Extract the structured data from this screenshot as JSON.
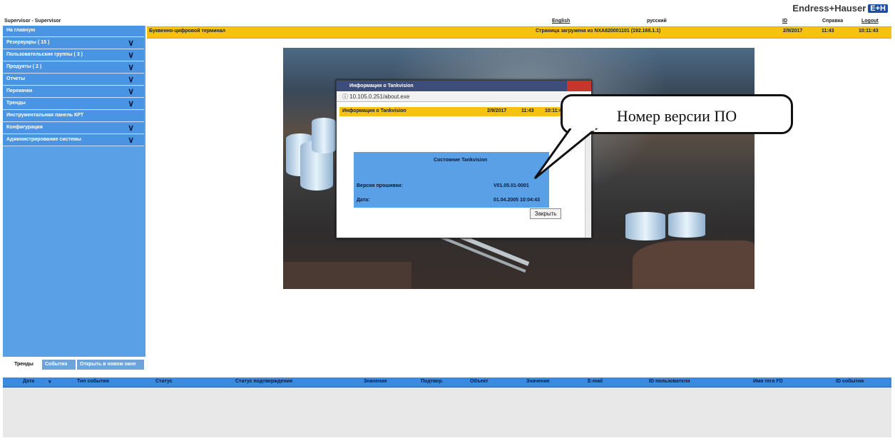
{
  "header": {
    "user": "Supervisor - Supervisor",
    "language_link": "English",
    "language_current": "русский",
    "link_id": "ID",
    "help": "Справка",
    "logout": "Logout",
    "brand": "Endress+Hauser",
    "brand_badge": "E+H"
  },
  "sidebar": {
    "items": [
      {
        "label": "На главную",
        "chevron": false
      },
      {
        "label": "Резервуары ( 15 )",
        "chevron": true
      },
      {
        "label": "Пользовательские группы ( 3 )",
        "chevron": true
      },
      {
        "label": "Продукты ( 2 )",
        "chevron": true
      },
      {
        "label": "Отчеты",
        "chevron": true
      },
      {
        "label": "Перекачки",
        "chevron": true
      },
      {
        "label": "Тренды",
        "chevron": true
      },
      {
        "label": "Инструментальная панель КРТ",
        "chevron": false
      },
      {
        "label": "Конфигурация",
        "chevron": true
      },
      {
        "label": "Администрирование системы",
        "chevron": true
      }
    ]
  },
  "titlebar": {
    "title": "Буквенно-цифровой терминал",
    "status": "Страница загружена из NXA820001101 (192.168.1.1)",
    "date": "2/9/2017",
    "time1": "11:43",
    "time2": "10:11:43"
  },
  "dialog": {
    "window_title": "Информация о Tankvision",
    "address": "10.105.0.251/about.exe",
    "header_title": "Информация о Tankvision",
    "header_date": "2/9/2017",
    "header_time1": "11:43",
    "header_time2": "10:11:43",
    "panel_title": "Состояние Tankvision",
    "version_label": "Версия прошивки:",
    "version_value": "V01.05.01-0001",
    "date_label": "Дата:",
    "date_value": "01.04.2005 10:04:43",
    "close_button": "Закрыть"
  },
  "callout": {
    "text": "Номер версии ПО"
  },
  "bottom_tabs": [
    {
      "label": "Тренды"
    },
    {
      "label": "События"
    },
    {
      "label": "Открыть в новом окне"
    }
  ],
  "grid": {
    "columns": [
      "Дата",
      "Тип события",
      "Статус",
      "Статус подтверждения",
      "Значение",
      "Подтвер.",
      "Объект",
      "Значение",
      "E-mail",
      "ID пользователя",
      "Имя тега FD",
      "ID события"
    ]
  },
  "colors": {
    "accent_yellow": "#f4c20f",
    "sidebar_blue": "#4a94e4",
    "grid_header_blue": "#3b8ae0",
    "brand_blue": "#1c4fa3"
  }
}
